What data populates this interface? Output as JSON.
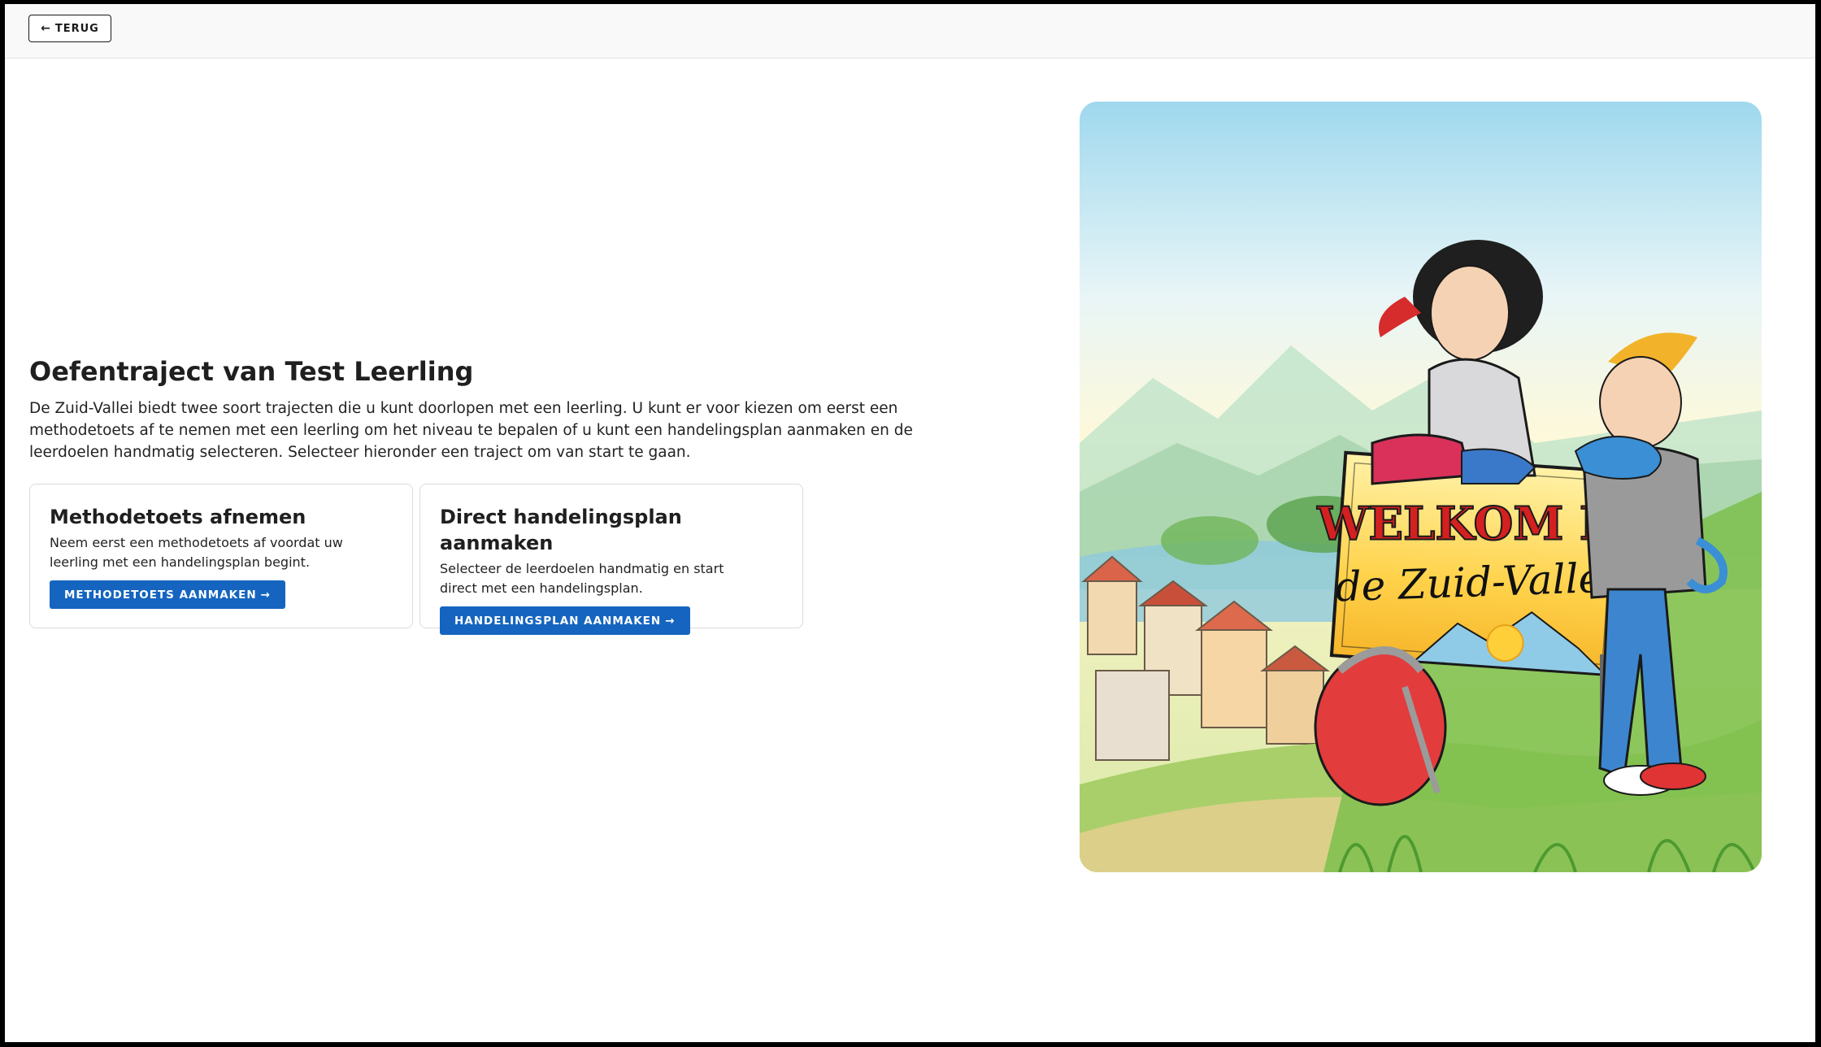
{
  "header": {
    "back_label": "TERUG",
    "back_icon": "arrow-left-icon"
  },
  "main": {
    "title": "Oefentraject van Test Leerling",
    "intro": "De Zuid-Vallei biedt twee soort trajecten die u kunt doorlopen met een leerling. U kunt er voor kiezen om eerst een methodetoets af te nemen met een leerling om het niveau te bepalen of u kunt een handelingsplan aanmaken en de leerdoelen handmatig selecteren. Selecteer hieronder een traject om van start te gaan."
  },
  "cards": [
    {
      "title": "Methodetoets afnemen",
      "description": "Neem eerst een methodetoets af voordat uw leerling met een handelingsplan begint.",
      "button_label": "METHODETOETS AANMAKEN",
      "button_icon": "arrow-right-icon"
    },
    {
      "title": "Direct handelingsplan aanmaken",
      "description": "Selecteer de leerdoelen handmatig en start direct met een handelingsplan.",
      "button_label": "HANDELINGSPLAN AANMAKEN",
      "button_icon": "arrow-right-icon"
    }
  ],
  "illustration": {
    "sign_line1": "WELKOM IN",
    "sign_line2": "de Zuid-Vallei"
  },
  "colors": {
    "primary_button": "#1565c0",
    "text": "#1f1f1f",
    "sign_red": "#d42020"
  }
}
